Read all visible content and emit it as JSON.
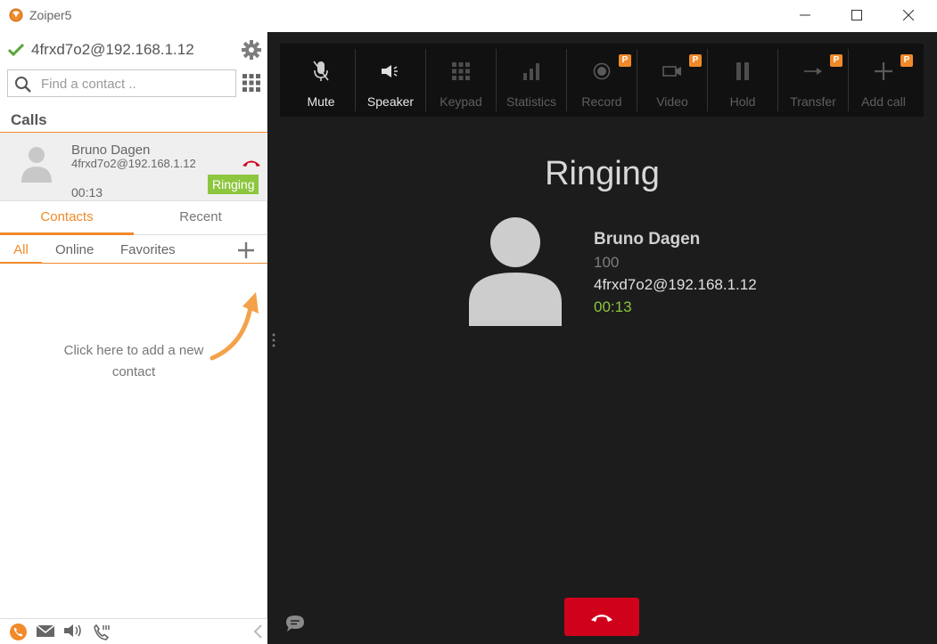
{
  "window": {
    "title": "Zoiper5",
    "logo_icon": "zoiper-logo-icon",
    "controls": [
      "minimize-icon",
      "maximize-icon",
      "close-icon"
    ]
  },
  "sidebar": {
    "account": {
      "status_icon": "checkmark-icon",
      "status_color": "#5aa63a",
      "address": "4frxd7o2@192.168.1.12"
    },
    "settings_icon": "gear-icon",
    "search": {
      "placeholder": "Find a contact ..",
      "value": ""
    },
    "dialpad_icon": "dialpad-icon",
    "calls_header": "Calls",
    "active_call": {
      "name": "Bruno Dagen",
      "uri": "4frxd7o2@192.168.1.12",
      "duration": "00:13",
      "status": "Ringing",
      "status_color": "#8dc63f"
    },
    "tabs": [
      {
        "label": "Contacts",
        "active": true
      },
      {
        "label": "Recent",
        "active": false
      }
    ],
    "filters": [
      {
        "label": "All",
        "active": true
      },
      {
        "label": "Online",
        "active": false
      },
      {
        "label": "Favorites",
        "active": false
      }
    ],
    "add_contact_hint": "Click here to add a new contact",
    "bottom_icons": [
      "phone-icon",
      "mail-icon",
      "speaker-icon",
      "call-settings-icon",
      "collapse-chevron-icon"
    ]
  },
  "call_panel": {
    "toolbar": [
      {
        "label": "Mute",
        "icon": "microphone-muted-icon",
        "enabled": true,
        "pro": false
      },
      {
        "label": "Speaker",
        "icon": "speaker-icon",
        "enabled": true,
        "pro": false
      },
      {
        "label": "Keypad",
        "icon": "keypad-icon",
        "enabled": false,
        "pro": false
      },
      {
        "label": "Statistics",
        "icon": "statistics-icon",
        "enabled": false,
        "pro": false
      },
      {
        "label": "Record",
        "icon": "record-icon",
        "enabled": false,
        "pro": true
      },
      {
        "label": "Video",
        "icon": "video-camera-icon",
        "enabled": false,
        "pro": true
      },
      {
        "label": "Hold",
        "icon": "pause-icon",
        "enabled": false,
        "pro": false
      },
      {
        "label": "Transfer",
        "icon": "transfer-arrow-icon",
        "enabled": false,
        "pro": true
      },
      {
        "label": "Add call",
        "icon": "plus-icon",
        "enabled": false,
        "pro": true
      }
    ],
    "pro_badge": "P",
    "status": "Ringing",
    "peer": {
      "name": "Bruno Dagen",
      "number": "100",
      "uri": "4frxd7o2@192.168.1.12",
      "duration": "00:13",
      "duration_color": "#8dc63f"
    },
    "hangup_color": "#d0021b",
    "accent_color": "#f08a2a"
  }
}
